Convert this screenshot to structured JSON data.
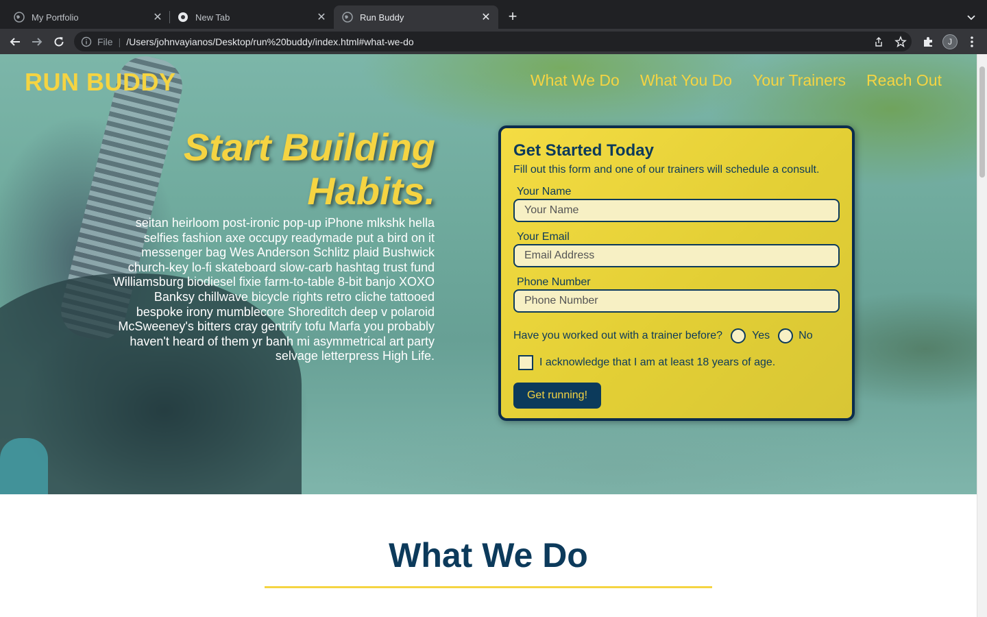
{
  "browser": {
    "tabs": [
      {
        "title": "My Portfolio",
        "active": false
      },
      {
        "title": "New Tab",
        "active": false
      },
      {
        "title": "Run Buddy",
        "active": true
      }
    ],
    "address": {
      "scheme_label": "File",
      "url": "/Users/johnvayianos/Desktop/run%20buddy/index.html#what-we-do"
    },
    "profile_initial": "J"
  },
  "page": {
    "brand": "RUN BUDDY",
    "nav": [
      "What We Do",
      "What You Do",
      "Your Trainers",
      "Reach Out"
    ],
    "hero": {
      "headline_line1": "Start Building",
      "headline_line2": "Habits.",
      "blurb": "seitan heirloom post-ironic pop-up iPhone mlkshk hella selfies fashion axe occupy readymade put a bird on it messenger bag Wes Anderson Schlitz plaid Bushwick church-key lo-fi skateboard slow-carb hashtag trust fund Williamsburg biodiesel fixie farm-to-table 8-bit banjo XOXO Banksy chillwave bicycle rights retro cliche tattooed bespoke irony mumblecore Shoreditch deep v polaroid McSweeney's bitters cray gentrify tofu Marfa you probably haven't heard of them yr banh mi asymmetrical art party selvage letterpress High Life."
    },
    "form": {
      "title": "Get Started Today",
      "subtitle": "Fill out this form and one of our trainers will schedule a consult.",
      "name_label": "Your Name",
      "name_placeholder": "Your Name",
      "email_label": "Your Email",
      "email_placeholder": "Email Address",
      "phone_label": "Phone Number",
      "phone_placeholder": "Phone Number",
      "trainer_question": "Have you worked out with a trainer before?",
      "yes_label": "Yes",
      "no_label": "No",
      "age_ack": "I acknowledge that I am at least 18 years of age.",
      "submit_label": "Get running!"
    },
    "section_title": "What We Do"
  },
  "colors": {
    "accent_yellow": "#f5d442",
    "navy": "#0c3a5b"
  }
}
